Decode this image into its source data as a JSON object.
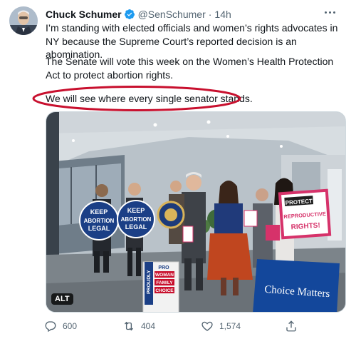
{
  "tweet": {
    "author_name": "Chuck Schumer",
    "handle": "@SenSchumer",
    "separator": "·",
    "time": "14h",
    "paragraphs": [
      "I’m standing with elected officials and women’s rights advocates in NY because the Supreme Court’s reported decision is an abomination.",
      "The Senate will vote this week on the Women’s Health Protection Act to protect abortion rights.",
      "We will see where every single senator stands."
    ],
    "media": {
      "alt_badge": "ALT",
      "signs": {
        "keep1": [
          "KEEP",
          "ABORTION",
          "LEGAL"
        ],
        "keep2": [
          "KEEP",
          "ABORTION",
          "LEGAL"
        ],
        "protect": [
          "PROTECT",
          "REPRODUCTIVE",
          "RIGHTS!"
        ],
        "choice": "Choice Matters",
        "podium": [
          "PROUDLY",
          "PRO",
          "WOMAN",
          "FAMILY",
          "CHOICE"
        ]
      }
    },
    "counts": {
      "replies": "600",
      "retweets": "404",
      "likes": "1,574"
    }
  },
  "colors": {
    "accent": "#1d9bf0",
    "highlight": "#c8102e",
    "muted": "#536471"
  }
}
